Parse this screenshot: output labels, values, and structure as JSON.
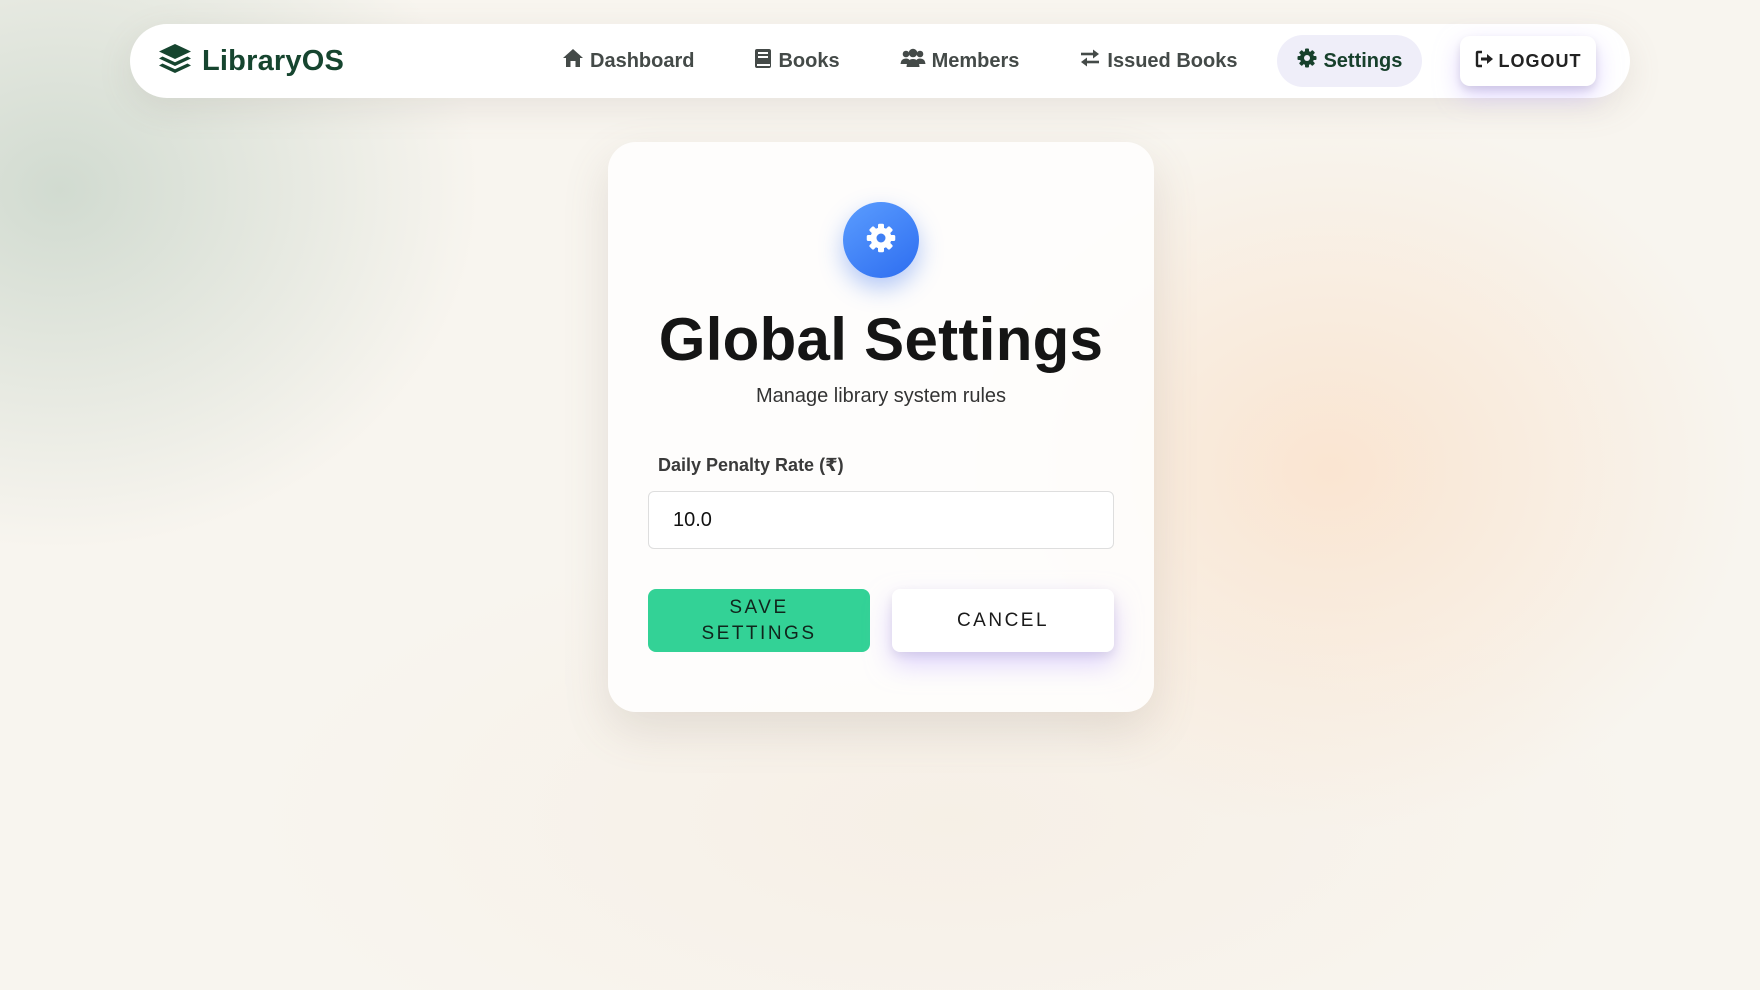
{
  "brand": {
    "name": "LibraryOS",
    "icon": "layers-icon",
    "color": "#16452f"
  },
  "nav": {
    "items": [
      {
        "label": "Dashboard",
        "icon": "home-icon"
      },
      {
        "label": "Books",
        "icon": "book-icon"
      },
      {
        "label": "Members",
        "icon": "users-icon"
      },
      {
        "label": "Issued Books",
        "icon": "exchange-icon"
      },
      {
        "label": "Settings",
        "icon": "gear-icon",
        "active": true
      }
    ],
    "logout_label": "LOGOUT",
    "logout_icon": "sign-out-icon"
  },
  "card": {
    "icon": "gear-icon",
    "title": "Global Settings",
    "subtitle": "Manage library system rules",
    "field_label": "Daily Penalty Rate (₹)",
    "field_value": "10.0",
    "save_label": "SAVE SETTINGS",
    "cancel_label": "CANCEL"
  },
  "colors": {
    "accent_green": "#33d296",
    "accent_blue": "#2d6df0",
    "nav_active_bg": "#efeef9"
  }
}
